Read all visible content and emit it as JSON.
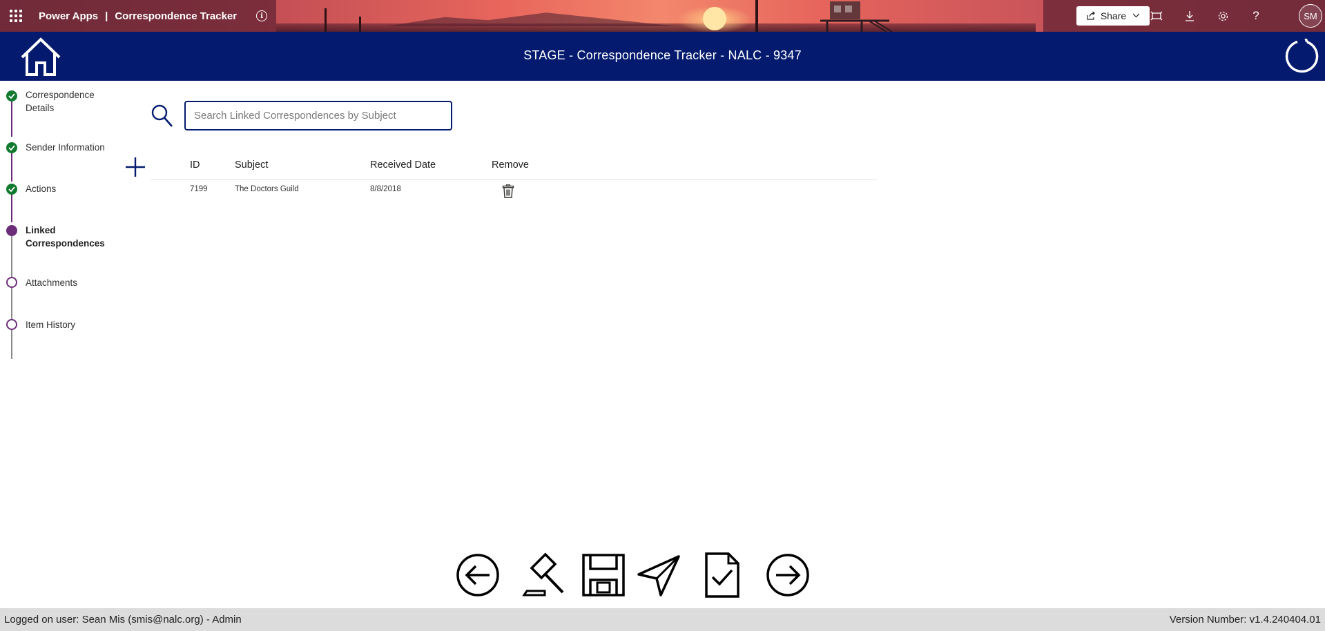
{
  "powerapps_bar": {
    "brand": "Power Apps",
    "separator": "|",
    "app_name": "Correspondence Tracker",
    "share_label": "Share",
    "avatar_initials": "SM"
  },
  "header": {
    "title": "STAGE - Correspondence Tracker  - NALC - 9347"
  },
  "steps": [
    {
      "label": "Correspondence Details",
      "state": "done"
    },
    {
      "label": "Sender Information",
      "state": "done"
    },
    {
      "label": "Actions",
      "state": "done"
    },
    {
      "label": "Linked Correspondences",
      "state": "current"
    },
    {
      "label": "Attachments",
      "state": "todo"
    },
    {
      "label": "Item History",
      "state": "todo"
    }
  ],
  "search": {
    "placeholder": "Search Linked Correspondences by Subject",
    "value": ""
  },
  "table": {
    "columns": [
      "ID",
      "Subject",
      "Received Date",
      "Remove"
    ],
    "rows": [
      {
        "id": "7199",
        "subject": "The Doctors Guild",
        "received_date": "8/8/2018"
      }
    ]
  },
  "actions": [
    {
      "name": "back",
      "icon": "arrow-left-circle-icon"
    },
    {
      "name": "legal",
      "icon": "gavel-icon"
    },
    {
      "name": "save",
      "icon": "save-icon"
    },
    {
      "name": "send",
      "icon": "send-icon"
    },
    {
      "name": "submit",
      "icon": "document-check-icon"
    },
    {
      "name": "next",
      "icon": "arrow-right-circle-icon"
    }
  ],
  "status": {
    "logged_on": "Logged on user: Sean Mis (smis@nalc.org) - Admin",
    "version": "Version Number: v1.4.240404.01"
  },
  "colors": {
    "header_bg": "#041a6e",
    "step_done": "#117a2e",
    "step_current": "#6b2d7a",
    "status_bar_bg": "#dcdcdc"
  }
}
